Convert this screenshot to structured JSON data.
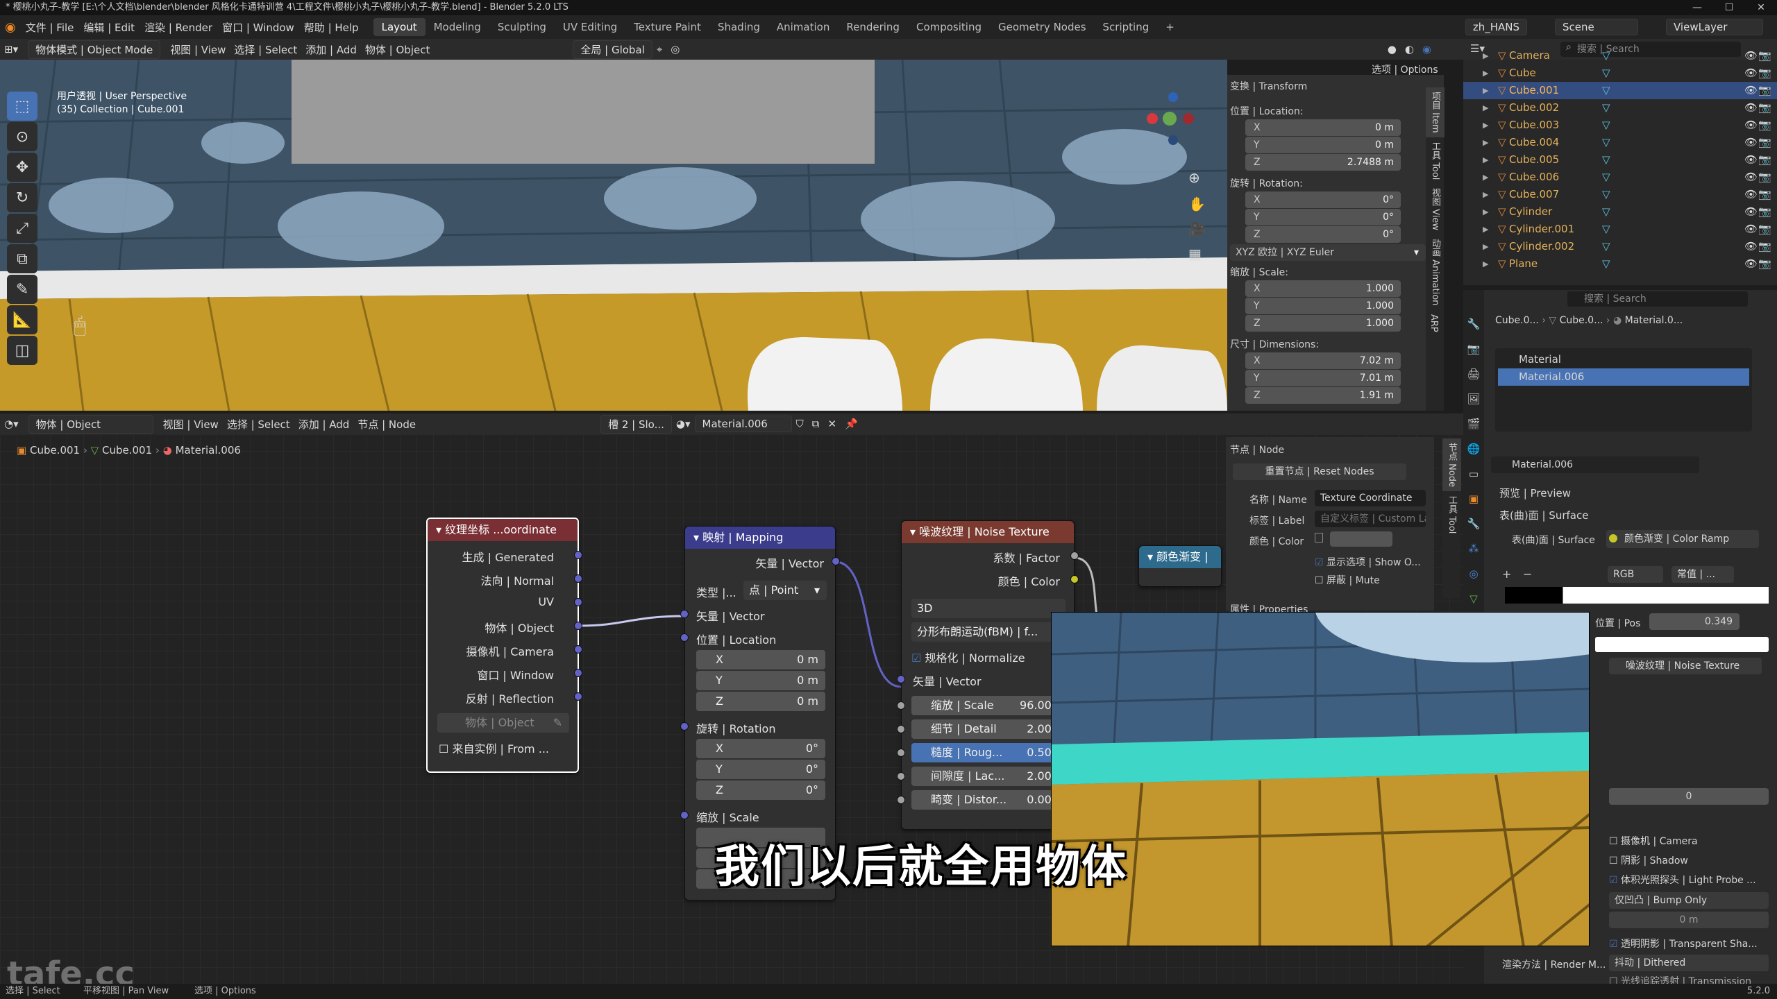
{
  "titlebar": {
    "text": "* 樱桃小丸子-教学 [E:\\个人文档\\blender\\blender 风格化卡通特训营 4\\工程文件\\樱桃小丸子\\樱桃小丸子-教学.blend] - Blender 5.2.0 LTS"
  },
  "menu": {
    "items": [
      "文件 | File",
      "编辑 | Edit",
      "渲染 | Render",
      "窗口 | Window",
      "帮助 | Help"
    ],
    "workspaces": [
      "Layout",
      "Modeling",
      "Sculpting",
      "UV Editing",
      "Texture Paint",
      "Shading",
      "Animation",
      "Rendering",
      "Compositing",
      "Geometry Nodes",
      "Scripting"
    ],
    "active_workspace": "Layout",
    "language": "zh_HANS",
    "scene": "Scene",
    "view_layer": "ViewLayer"
  },
  "viewport_header": {
    "mode": "物体模式 | Object Mode",
    "menus": [
      "视图 | View",
      "选择 | Select",
      "添加 | Add",
      "物体 | Object"
    ],
    "pivot": "全局 | Global",
    "options": "选项 | Options"
  },
  "viewport": {
    "view_name": "用户透视 | User Perspective",
    "collection": "(35) Collection | Cube.001"
  },
  "npanel": {
    "section": "变换 | Transform",
    "location_label": "位置 | Location:",
    "location": [
      {
        "axis": "X",
        "value": "0 m"
      },
      {
        "axis": "Y",
        "value": "0 m"
      },
      {
        "axis": "Z",
        "value": "2.7488 m"
      }
    ],
    "rotation_label": "旋转 | Rotation:",
    "rotation": [
      {
        "axis": "X",
        "value": "0°"
      },
      {
        "axis": "Y",
        "value": "0°"
      },
      {
        "axis": "Z",
        "value": "0°"
      }
    ],
    "rotation_mode": "XYZ 欧拉 | XYZ Euler",
    "scale_label": "缩放 | Scale:",
    "scale": [
      {
        "axis": "X",
        "value": "1.000"
      },
      {
        "axis": "Y",
        "value": "1.000"
      },
      {
        "axis": "Z",
        "value": "1.000"
      }
    ],
    "dimensions_label": "尺寸 | Dimensions:",
    "dimensions": [
      {
        "axis": "X",
        "value": "7.02 m"
      },
      {
        "axis": "Y",
        "value": "7.01 m"
      },
      {
        "axis": "Z",
        "value": "1.91 m"
      }
    ],
    "tabs": [
      "项目 Item",
      "工具 Tool",
      "视图 View",
      "动画 Animation",
      "ARP"
    ]
  },
  "outliner": {
    "search_placeholder": "搜索 | Search",
    "rows": [
      {
        "name": "Camera",
        "selected": false
      },
      {
        "name": "Cube",
        "selected": false
      },
      {
        "name": "Cube.001",
        "selected": true
      },
      {
        "name": "Cube.002",
        "selected": false
      },
      {
        "name": "Cube.003",
        "selected": false
      },
      {
        "name": "Cube.004",
        "selected": false
      },
      {
        "name": "Cube.005",
        "selected": false
      },
      {
        "name": "Cube.006",
        "selected": false
      },
      {
        "name": "Cube.007",
        "selected": false
      },
      {
        "name": "Cylinder",
        "selected": false
      },
      {
        "name": "Cylinder.001",
        "selected": false
      },
      {
        "name": "Cylinder.002",
        "selected": false
      },
      {
        "name": "Plane",
        "selected": false
      }
    ]
  },
  "properties": {
    "search_placeholder": "搜索 | Search",
    "breadcrumb": [
      "Cube.0...",
      "Cube.0...",
      "Material.0..."
    ],
    "slots": [
      {
        "name": "Material",
        "selected": false
      },
      {
        "name": "Material.006",
        "selected": true
      }
    ],
    "material_name": "Material.006",
    "preview": "预览 | Preview",
    "surface_section": "表(曲)面 | Surface",
    "surface_label": "表(曲)面 | Surface",
    "surface_value": "颜色渐变 | Color Ramp",
    "color_mode": "RGB",
    "interp": "常值 | ...",
    "pos_label": "位置 | Pos",
    "pos_value": "0.349",
    "fac_input": "噪波纹理 | Noise Texture",
    "ior_value": "0",
    "camera": "摄像机 | Camera",
    "shadow": "阴影 | Shadow",
    "light_probe": "体积光照探头 | Light Probe ...",
    "displacement": "仅凹凸 | Bump Only",
    "disp_value": "0 m",
    "transparent_shadow": "透明阴影 | Transparent Sha...",
    "render_method_label": "渲染方法 | Render M...",
    "render_method": "抖动 | Dithered",
    "transmission": "光线追踪透射 | Transmission"
  },
  "node_header": {
    "mode": "物体 | Object",
    "menus": [
      "视图 | View",
      "选择 | Select",
      "添加 | Add",
      "节点 | Node"
    ],
    "slot": "槽 2 | Slo...",
    "material": "Material.006"
  },
  "node_breadcrumb": [
    "Cube.001",
    "Cube.001",
    "Material.006"
  ],
  "node_panel": {
    "section": "节点 | Node",
    "reset": "重置节点 | Reset Nodes",
    "name_label": "名称 | Name",
    "name_value": "Texture Coordinate",
    "label_label": "标签 | Label",
    "label_placeholder": "自定义标签 | Custom La",
    "color_label": "颜色 | Color",
    "show_options": "显示选项 | Show O...",
    "mute": "屏蔽 | Mute",
    "properties": "属性 | Properties",
    "tabs": [
      "节点 Node",
      "工具 Tool"
    ]
  },
  "nodes": {
    "texcoord": {
      "title": "纹理坐标 ...oordinate",
      "outputs": [
        "生成 | Generated",
        "法向 | Normal",
        "UV",
        "物体 | Object",
        "摄像机 | Camera",
        "窗口 | Window",
        "反射 | Reflection"
      ],
      "object_field": "物体 | Object",
      "from_instancer": "来自实例 | From ..."
    },
    "mapping": {
      "title": "映射 | Mapping",
      "output": "矢量 | Vector",
      "type_label": "类型 |...",
      "type_value": "点 | Point",
      "vector_in": "矢量 | Vector",
      "location": "位置 | Location",
      "loc": [
        {
          "axis": "X",
          "value": "0 m"
        },
        {
          "axis": "Y",
          "value": "0 m"
        },
        {
          "axis": "Z",
          "value": "0 m"
        }
      ],
      "rotation": "旋转 | Rotation",
      "rot": [
        {
          "axis": "X",
          "value": "0°"
        },
        {
          "axis": "Y",
          "value": "0°"
        },
        {
          "axis": "Z",
          "value": "0°"
        }
      ],
      "scale": "缩放 | Scale"
    },
    "noise": {
      "title": "噪波纹理 | Noise Texture",
      "out_factor": "系数 | Factor",
      "out_color": "颜色 | Color",
      "dimensions": "3D",
      "type": "分形布朗运动(fBM) | f...",
      "normalize": "规格化 | Normalize",
      "vector": "矢量 | Vector",
      "inputs": [
        {
          "label": "缩放 | Scale",
          "value": "96.000",
          "highlight": false
        },
        {
          "label": "细节 | Detail",
          "value": "2.000",
          "highlight": false
        },
        {
          "label": "糙度 | Roug...",
          "value": "0.500",
          "highlight": true
        },
        {
          "label": "间隙度 | Lac...",
          "value": "2.000",
          "highlight": false
        },
        {
          "label": "畸变 | Distor...",
          "value": "0.000",
          "highlight": false
        }
      ]
    },
    "colorramp": {
      "title": "颜色渐变 |"
    }
  },
  "subtitle": "我们以后就全用物体",
  "watermark": "tafe.cc",
  "statusbar": {
    "items": [
      "选择 | Select",
      "平移视图 | Pan View",
      "选项 | Options"
    ],
    "version": "5.2.0"
  },
  "colors": {
    "accent": "#4772b3",
    "selected_row": "#334d80",
    "object_orange": "#e4b15a",
    "node_texture": "#7a3a2f",
    "node_vector": "#3c3c8c",
    "node_converter": "#2e6a8c",
    "socket_vector": "#6363c7",
    "socket_float": "#a1a1a1",
    "socket_color": "#c7c729"
  }
}
